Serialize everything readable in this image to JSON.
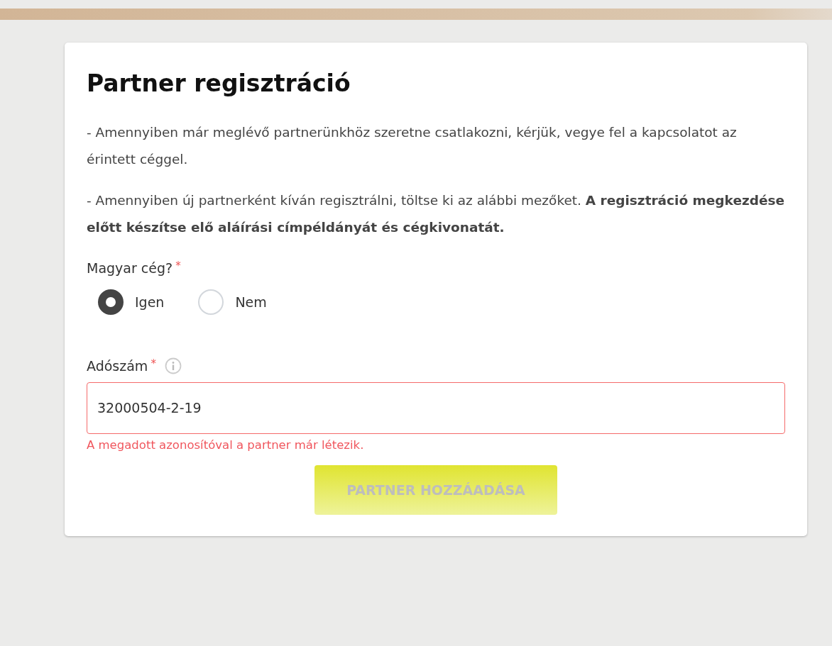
{
  "title": "Partner regisztráció",
  "paragraphs": [
    "- Amennyiben már meglévő partnerünkhöz szeretne csatlakozni, kérjük, vegye fel a kapcsolatot az érintett céggel.",
    "- Amennyiben új partnerként kíván regisztrálni, töltse ki az alábbi mezőket. **A regisztráció megkezdése előtt készítse elő aláírási címpéldányát és cégkivonatát.**"
  ],
  "hungarian_company": {
    "label": "Magyar cég?",
    "required_mark": "*",
    "options": [
      {
        "label": "Igen",
        "selected": true
      },
      {
        "label": "Nem",
        "selected": false
      }
    ]
  },
  "tax_number": {
    "label": "Adószám",
    "required_mark": "*",
    "value": "32000504-2-19",
    "invalid": true,
    "error": "A megadott azonosítóval a partner már létezik."
  },
  "submit": {
    "label": "PARTNER HOZZÁADÁSA",
    "disabled": true
  }
}
